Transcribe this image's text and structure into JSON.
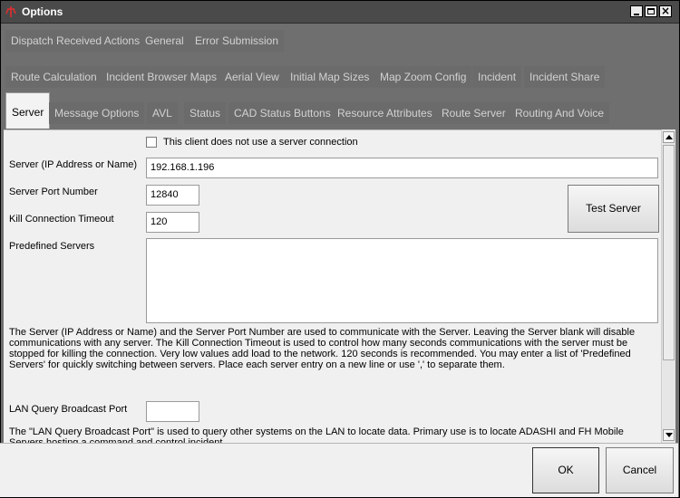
{
  "window": {
    "title": "Options"
  },
  "tabs": {
    "row1": [
      "Dispatch Received Actions",
      "General",
      "Error Submission"
    ],
    "row2": [
      "Route Calculation",
      "Incident Browser Maps",
      "Aerial View",
      "Initial Map Sizes",
      "Map Zoom Config",
      "Incident",
      "Incident Share"
    ],
    "row3": [
      "Server",
      "Message Options",
      "AVL",
      "Status",
      "CAD Status Buttons",
      "Resource Attributes",
      "Route Server",
      "Routing And Voice"
    ],
    "active": "Server"
  },
  "server": {
    "no_server_label": "This client does not use a server connection",
    "no_server_checked": false,
    "server_label": "Server (IP Address or Name)",
    "server_value": "192.168.1.196",
    "port_label": "Server Port Number",
    "port_value": "12840",
    "timeout_label": "Kill Connection Timeout",
    "timeout_value": "120",
    "predefined_label": "Predefined Servers",
    "predefined_value": "",
    "test_button": "Test Server",
    "help_text": "The Server (IP Address or Name) and the Server Port Number are used to communicate with the Server.  Leaving the Server blank will disable communications with any server.  The Kill Connection Timeout is used to control how many seconds communications with the server must be stopped for killing the connection.  Very low values add load to the network.  120 seconds is recommended.  You may enter a list of 'Predefined Servers' for quickly switching between servers.  Place each server entry on a new line or use ',' to separate them.",
    "lan_label": "LAN Query Broadcast Port",
    "lan_value": "",
    "lan_help": "The \"LAN Query Broadcast Port\" is used to query other systems on the LAN to locate data.   Primary use is to locate ADASHI and FH Mobile Servers hosting a command and control incident."
  },
  "footer": {
    "ok": "OK",
    "cancel": "Cancel"
  },
  "colors": {
    "titlebar": "#4a4a4a",
    "tab_bg": "#6b6b6b",
    "tab_text": "#d2d2d2",
    "panel": "#f0f0f0"
  }
}
